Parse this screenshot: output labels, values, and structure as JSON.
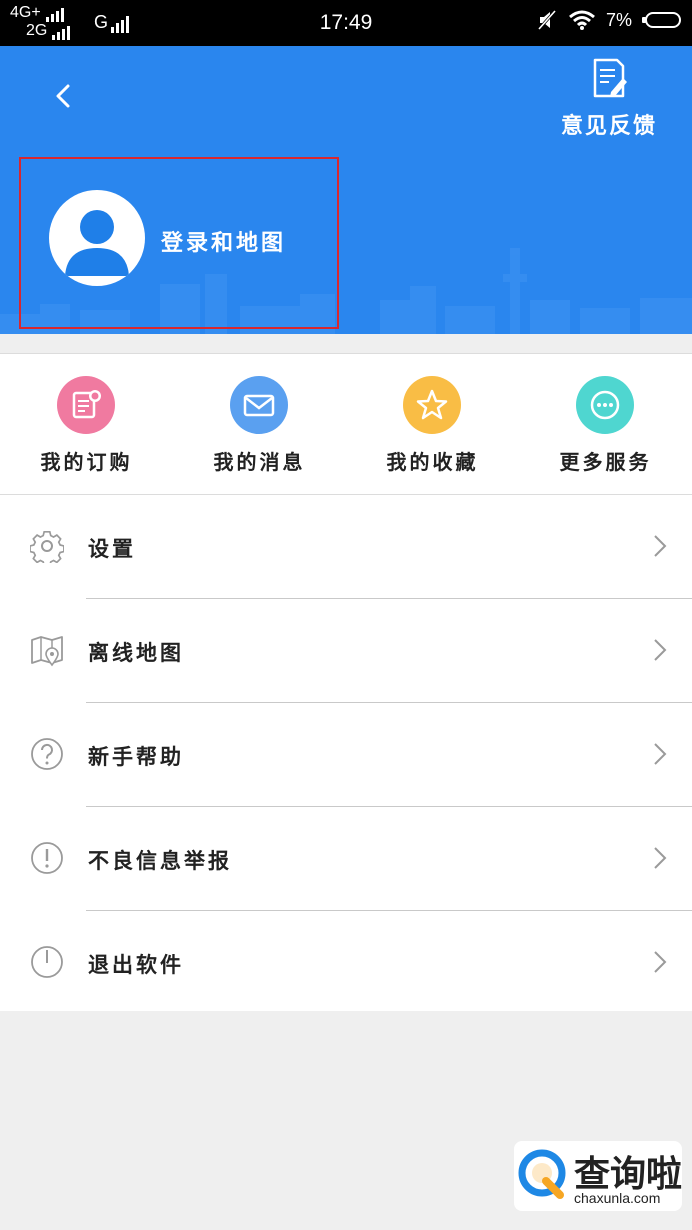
{
  "status_bar": {
    "network_1": "4G+",
    "network_2": "2G",
    "network_3": "G",
    "time": "17:49",
    "battery": "7%",
    "icons": [
      "signal-icon",
      "mute-icon",
      "wifi-icon",
      "battery-icon"
    ]
  },
  "header": {
    "back_icon": "chevron-left-icon",
    "feedback_label": "意见反馈",
    "login_label": "登录和地图",
    "background_color": "#2a86ee"
  },
  "shortcuts": [
    {
      "label": "我的订购",
      "icon": "order-icon",
      "color": "#f07aa0"
    },
    {
      "label": "我的消息",
      "icon": "mail-icon",
      "color": "#5aa0f0"
    },
    {
      "label": "我的收藏",
      "icon": "star-icon",
      "color": "#f9bd45"
    },
    {
      "label": "更多服务",
      "icon": "more-icon",
      "color": "#4fd6d0"
    }
  ],
  "menu": [
    {
      "label": "设置",
      "icon": "gear-icon"
    },
    {
      "label": "离线地图",
      "icon": "offline-map-icon"
    },
    {
      "label": "新手帮助",
      "icon": "help-icon"
    },
    {
      "label": "不良信息举报",
      "icon": "report-icon"
    },
    {
      "label": "退出软件",
      "icon": "power-icon"
    }
  ],
  "watermark": {
    "name": "查询啦",
    "url": "chaxunla.com"
  }
}
